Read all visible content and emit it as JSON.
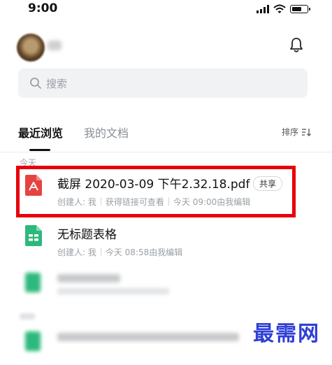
{
  "status_bar": {
    "time": "9:00"
  },
  "search": {
    "placeholder": "搜索"
  },
  "tabs": [
    {
      "label": "最近浏览",
      "active": true
    },
    {
      "label": "我的文档",
      "active": false
    }
  ],
  "sort": {
    "label": "排序"
  },
  "groups": {
    "today": "今天"
  },
  "files": [
    {
      "name": "截屏 2020-03-09 下午2.32.18.pdf",
      "icon": "pdf-icon",
      "badge": "共享",
      "meta": [
        "创建人: 我",
        "获得链接可查看",
        "今天 09:00由我编辑"
      ],
      "highlighted": true
    },
    {
      "name": "无标题表格",
      "icon": "sheet-icon",
      "meta": [
        "创建人: 我",
        "今天 08:58由我编辑"
      ]
    }
  ],
  "colors": {
    "highlight": "#e8000b",
    "pdf": "#e64340",
    "sheet": "#2db87d",
    "watermark": "#2f3fd6"
  },
  "watermark": "最需网"
}
